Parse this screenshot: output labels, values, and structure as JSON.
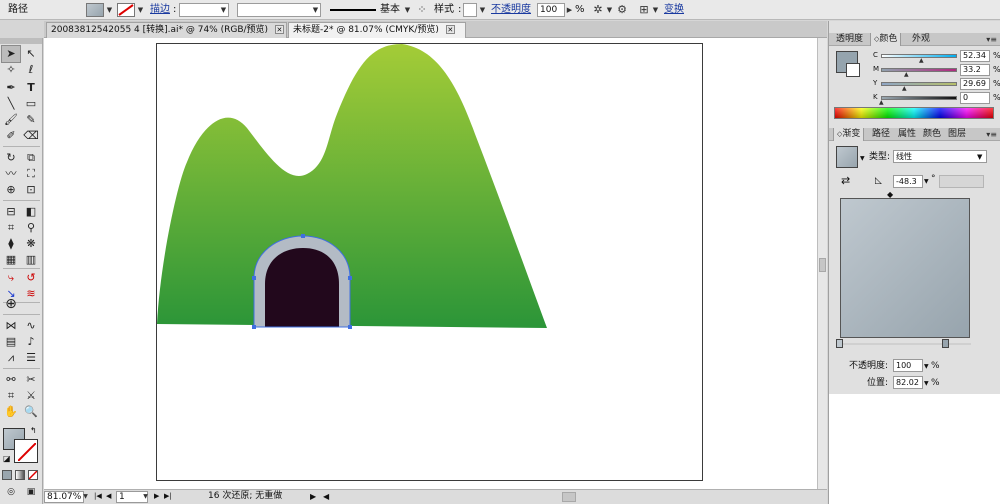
{
  "control_bar": {
    "object_label": "路径",
    "stroke_label": "描边",
    "stroke_profile_label": "基本",
    "style_label": "样式",
    "opacity_label": "不透明度",
    "opacity_value": "100",
    "opacity_unit": "%",
    "transform_label": "变换"
  },
  "document_tabs": [
    {
      "label": "20083812542055 4 [转换].ai* @ 74% (RGB/预览)"
    },
    {
      "label": "未标题-2* @ 81.07% (CMYK/预览)"
    }
  ],
  "status_bar": {
    "zoom": "81.07%",
    "artboard_index": "1",
    "history_text": "16 次还原; 无重做"
  },
  "color_panel": {
    "tabs": [
      "透明度",
      "颜色",
      "外观"
    ],
    "active_tab": "颜色",
    "channels": [
      {
        "label": "C",
        "value": "52.34",
        "fraction": 0.52
      },
      {
        "label": "M",
        "value": "33.2",
        "fraction": 0.33
      },
      {
        "label": "Y",
        "value": "29.69",
        "fraction": 0.3
      },
      {
        "label": "K",
        "value": "0",
        "fraction": 0.0
      }
    ],
    "unit": "%"
  },
  "gradient_panel": {
    "tabs": [
      "渐变",
      "路径",
      "属性",
      "颜色",
      "图层"
    ],
    "active_tab": "渐变",
    "type_label": "类型:",
    "type_value": "线性",
    "angle_value": "-48.3",
    "angle_unit": "°",
    "opacity_label": "不透明度:",
    "opacity_value": "100",
    "location_label": "位置:",
    "location_value": "82.02",
    "unit": "%"
  },
  "colors": {
    "mountain_top": "#a4cc37",
    "mountain_bottom": "#2b9538",
    "tunnel_frame": "#b3bbc5",
    "tunnel_inside": "#22081c",
    "selection_blue": "#3f6fe0",
    "gradient_light": "#bfc8cf",
    "gradient_dark": "#97a4ad"
  }
}
